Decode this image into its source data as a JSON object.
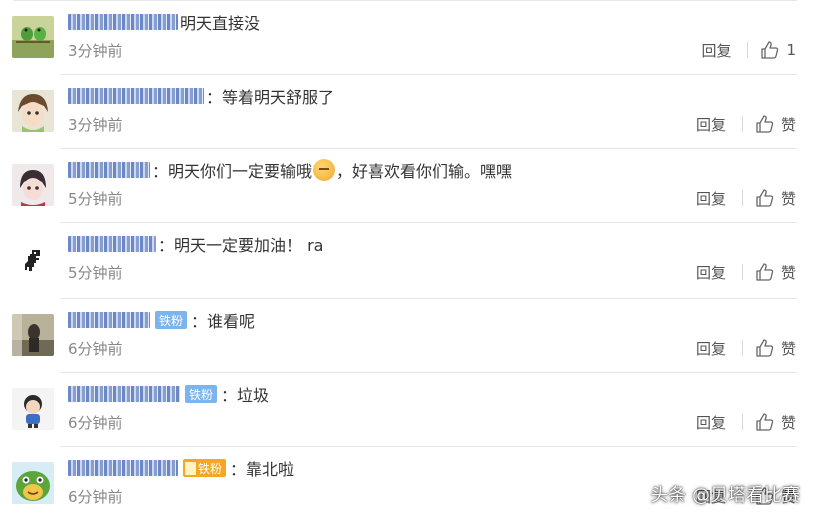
{
  "comments": [
    {
      "text": "明天直接没",
      "time": "3分钟前",
      "reply": "回复",
      "like": "1",
      "badge": ""
    },
    {
      "text": "：等着明天舒服了",
      "time": "3分钟前",
      "reply": "回复",
      "like": "赞",
      "badge": ""
    },
    {
      "text": "：明天你们一定要输哦",
      "text2": "，好喜欢看你们输。嘿嘿",
      "time": "5分钟前",
      "reply": "回复",
      "like": "赞",
      "badge": ""
    },
    {
      "text": "：明天一定要加油！ ra",
      "time": "5分钟前",
      "reply": "回复",
      "like": "赞",
      "badge": ""
    },
    {
      "text": "：谁看呢",
      "time": "6分钟前",
      "reply": "回复",
      "like": "赞",
      "badge": "铁粉"
    },
    {
      "text": "：垃圾",
      "time": "6分钟前",
      "reply": "回复",
      "like": "赞",
      "badge": "铁粉"
    },
    {
      "text": "：靠北啦",
      "time": "6分钟前",
      "reply": "回复",
      "like": "赞",
      "badge": "铁粉"
    }
  ],
  "watermark": "头条 @贝塔看比赛",
  "colors": {
    "accent": "#7bb5ee",
    "badge_gold": "#f5a623",
    "divider": "#e6e6e6",
    "time": "#888888"
  }
}
